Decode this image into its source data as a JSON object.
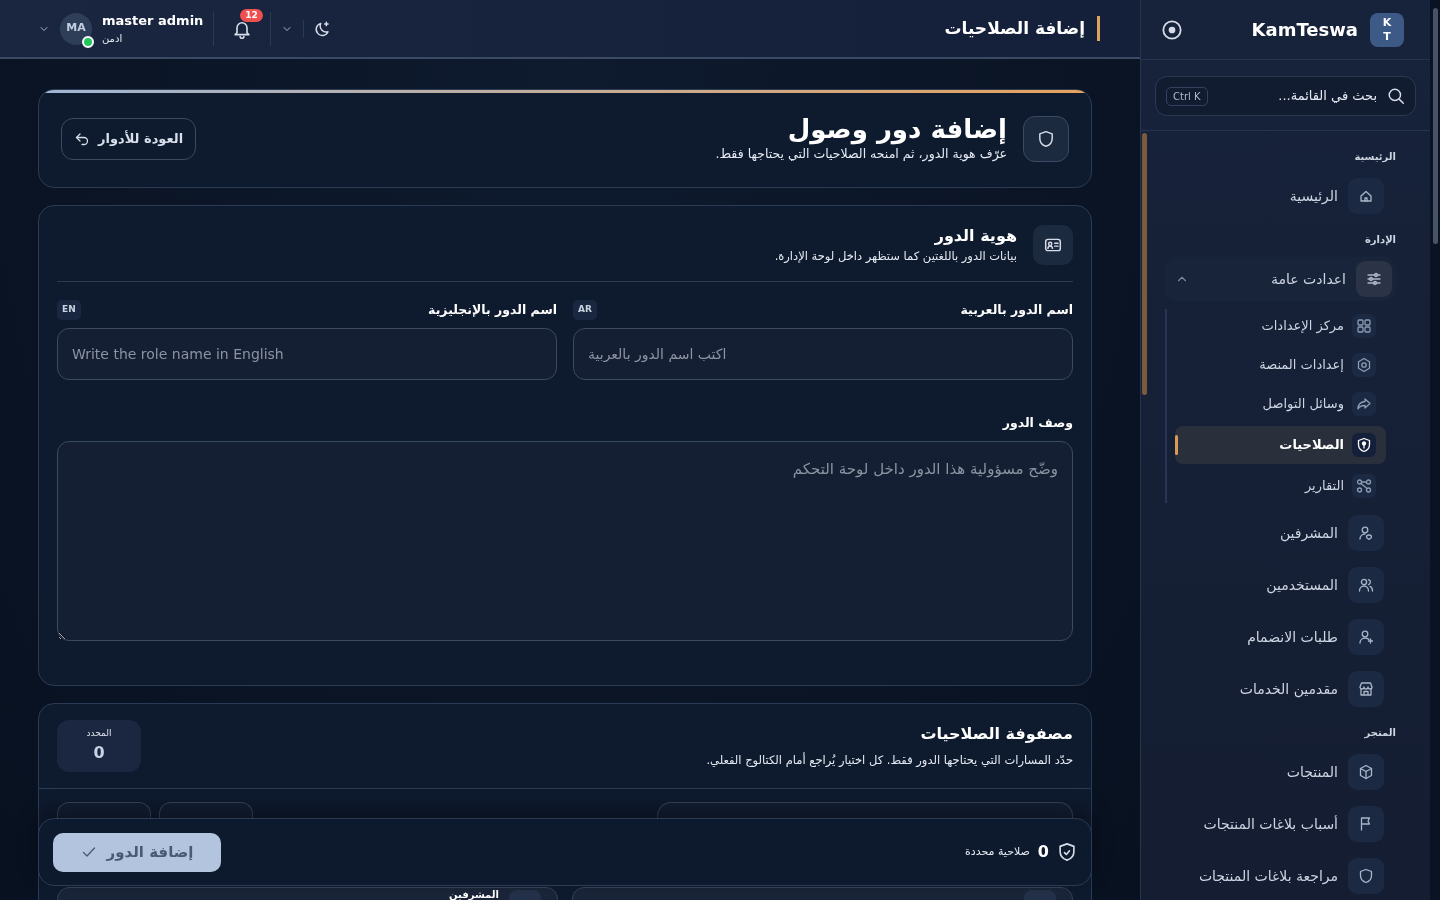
{
  "topbar": {
    "title": "إضافة الصلاحيات",
    "notifications": "12",
    "user": {
      "initials": "MA",
      "name": "master admin",
      "role": "ادمن",
      "online": true
    }
  },
  "sidebar": {
    "brand": {
      "logo_letters": [
        "K",
        "T"
      ],
      "name": "KamTeswa"
    },
    "search": {
      "placeholder": "بحث في القائمة...",
      "shortcut": "Ctrl K"
    },
    "sections": [
      {
        "title": "الرئيسية",
        "items": [
          {
            "label": "الرئيسية",
            "selected": false
          }
        ]
      },
      {
        "title": "الإدارة",
        "items": [
          {
            "label": "اعدادت عامة",
            "selected": false,
            "expanded": true,
            "children": [
              {
                "label": "مركز الإعدادات",
                "selected": false
              },
              {
                "label": "إعدادات المنصة",
                "selected": false
              },
              {
                "label": "وسائل التواصل",
                "selected": false
              },
              {
                "label": "الصلاحيات",
                "selected": true
              },
              {
                "label": "التقارير",
                "selected": false
              }
            ]
          },
          {
            "label": "المشرفين",
            "selected": false
          },
          {
            "label": "المستخدمين",
            "selected": false
          },
          {
            "label": "طلبات الانضمام",
            "selected": false
          },
          {
            "label": "مقدمين الخدمات",
            "selected": false
          }
        ]
      },
      {
        "title": "المتجر",
        "items": [
          {
            "label": "المنتجات",
            "selected": false
          },
          {
            "label": "أسباب بلاغات المنتجات",
            "selected": false
          },
          {
            "label": "مراجعة بلاغات المنتجات",
            "selected": false
          }
        ]
      }
    ]
  },
  "page_header": {
    "title": "إضافة دور وصول",
    "subtitle": "عرّف هوية الدور، ثم امنحه الصلاحيات التي يحتاجها فقط.",
    "back_button": "العودة للأدوار"
  },
  "identity": {
    "title": "هوية الدور",
    "subtitle": "بيانات الدور باللغتين كما ستظهر داخل لوحة الإدارة.",
    "fields": [
      {
        "label": "اسم الدور بالعربية",
        "lang": "AR",
        "placeholder": "اكتب اسم الدور بالعربية"
      },
      {
        "label": "اسم الدور بالإنجليزية",
        "lang": "EN",
        "placeholder": "Write the role name in English"
      }
    ],
    "description": {
      "label": "وصف الدور",
      "placeholder": "وضّح مسؤولية هذا الدور داخل لوحة التحكم"
    }
  },
  "matrix": {
    "title": "مصفوفة الصلاحيات",
    "subtitle": "حدّد المسارات التي يحتاجها الدور فقط. كل اختيار يُراجع أمام الكتالوج الفعلي.",
    "counter": {
      "label": "المحدد",
      "value": "0"
    },
    "groups": [
      {
        "kind": "empty"
      },
      {
        "kind": "titled",
        "title": "المشرفين"
      }
    ]
  },
  "footer": {
    "count": "0",
    "label": "صلاحية محددة",
    "submit": {
      "label": "إضافة الدور",
      "disabled": true
    }
  }
}
